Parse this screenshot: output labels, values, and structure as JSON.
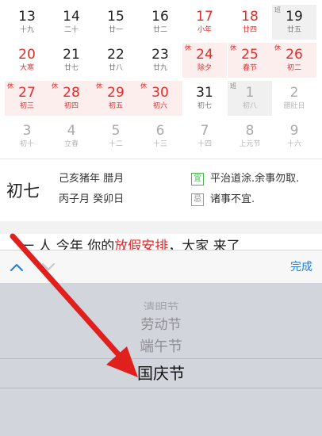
{
  "calendar": {
    "weeks": [
      [
        {
          "day": "13",
          "lunar": "十九",
          "style": ""
        },
        {
          "day": "14",
          "lunar": "二十",
          "style": ""
        },
        {
          "day": "15",
          "lunar": "廿一",
          "style": ""
        },
        {
          "day": "16",
          "lunar": "廿二",
          "style": ""
        },
        {
          "day": "17",
          "lunar": "小年",
          "style": "red"
        },
        {
          "day": "18",
          "lunar": "廿四",
          "style": "red"
        },
        {
          "day": "19",
          "lunar": "廿五",
          "style": "workday",
          "tag": "班"
        }
      ],
      [
        {
          "day": "20",
          "lunar": "大寒",
          "style": "red"
        },
        {
          "day": "21",
          "lunar": "廿七",
          "style": ""
        },
        {
          "day": "22",
          "lunar": "廿八",
          "style": ""
        },
        {
          "day": "23",
          "lunar": "廿九",
          "style": ""
        },
        {
          "day": "24",
          "lunar": "除夕",
          "style": "red holiday",
          "tag": "休"
        },
        {
          "day": "25",
          "lunar": "春节",
          "style": "red holiday",
          "tag": "休"
        },
        {
          "day": "26",
          "lunar": "初二",
          "style": "red holiday",
          "tag": "休"
        }
      ],
      [
        {
          "day": "27",
          "lunar": "初三",
          "style": "red holiday",
          "tag": "休"
        },
        {
          "day": "28",
          "lunar": "初四",
          "style": "red holiday",
          "tag": "休"
        },
        {
          "day": "29",
          "lunar": "初五",
          "style": "red holiday",
          "tag": "休"
        },
        {
          "day": "30",
          "lunar": "初六",
          "style": "red holiday",
          "tag": "休"
        },
        {
          "day": "31",
          "lunar": "初七",
          "style": ""
        },
        {
          "day": "1",
          "lunar": "初八",
          "style": "dim today",
          "tag": "班"
        },
        {
          "day": "2",
          "lunar": "腊肚日",
          "style": "dim"
        }
      ],
      [
        {
          "day": "3",
          "lunar": "初十",
          "style": "dim"
        },
        {
          "day": "4",
          "lunar": "立春",
          "style": "dim"
        },
        {
          "day": "5",
          "lunar": "十二",
          "style": "dim"
        },
        {
          "day": "6",
          "lunar": "十三",
          "style": "dim"
        },
        {
          "day": "7",
          "lunar": "十四",
          "style": "dim"
        },
        {
          "day": "8",
          "lunar": "上元节",
          "style": "dim"
        },
        {
          "day": "9",
          "lunar": "十六",
          "style": "dim"
        }
      ]
    ]
  },
  "day_info": {
    "lunar_day": "初七",
    "ganzhi_line1": "己亥猪年 腊月",
    "ganzhi_line2": "丙子月 癸卯日",
    "yi_label": "宜",
    "yi_text": "平治道涂.余事勿取.",
    "ji_label": "忌",
    "ji_text": "诸事不宜."
  },
  "article": {
    "prefix": "一 人 今年 你的",
    "link": "放假安排",
    "suffix": "，大家 来了"
  },
  "toolbar": {
    "done_label": "完成",
    "up_icon": "chevron-up-icon",
    "down_icon": "chevron-down-icon",
    "accent_color": "#1e7fd6"
  },
  "picker": {
    "options": [
      "清明节",
      "劳动节",
      "端午节"
    ],
    "selected": "国庆节"
  }
}
